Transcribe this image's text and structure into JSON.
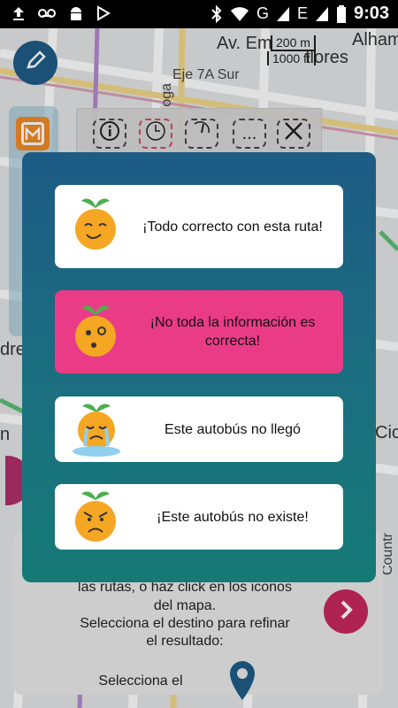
{
  "status_bar": {
    "time": "9:03",
    "network": "G",
    "network2": "E"
  },
  "map": {
    "street_labels": [
      "Av. Em",
      "flores",
      "Alhamb",
      "Eje 7A Sur",
      "oga",
      "dres",
      "n",
      "Cicl",
      "Countr"
    ],
    "scale": {
      "top": "200 m",
      "bottom": "1000 ft"
    }
  },
  "toolbar": {
    "info_icon": "info-icon",
    "clock_icon": "clock-icon",
    "more_label": "...",
    "close_icon": "close-icon"
  },
  "feedback_options": [
    {
      "label": "¡Todo correcto con esta ruta!",
      "face": "happy",
      "color": "#ffffff"
    },
    {
      "label": "¡No toda la información es correcta!",
      "face": "confused",
      "color": "#ea3c86"
    },
    {
      "label": "Este autobús no llegó",
      "face": "crying",
      "color": "#ffffff"
    },
    {
      "label": "¡Este autobús no existe!",
      "face": "angry",
      "color": "#ffffff"
    }
  ],
  "bottom_panel": {
    "line1": "las rutas, o haz click en los iconos",
    "line2": "del mapa.",
    "line3": "Selecciona el destino para refinar",
    "line4": "el resultado:",
    "line5": "Selecciona el"
  },
  "colors": {
    "modal_top": "#1d5b84",
    "modal_bottom": "#157a76",
    "accent_pink": "#ea3c86",
    "orange": "#f5a623"
  }
}
